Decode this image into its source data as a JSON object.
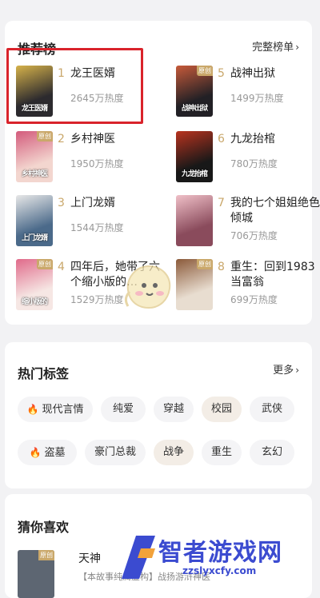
{
  "ranking": {
    "title": "推荐榜",
    "more": "完整榜单",
    "books": [
      {
        "rank": "1",
        "title": "龙王医婿",
        "heat": "2645万热度",
        "cover_text": "龙王医婿",
        "cover_color": "#2c2a2e",
        "cover_accent": "#d6b24a"
      },
      {
        "rank": "5",
        "title": "战神出狱",
        "heat": "1499万热度",
        "cover_text": "战神出狱",
        "cover_color": "#222025",
        "cover_accent": "#c75a3a",
        "badge": "原创"
      },
      {
        "rank": "2",
        "title": "乡村神医",
        "heat": "1950万热度",
        "cover_text": "乡村神医",
        "cover_color": "#f3d6cf",
        "cover_accent": "#d35b7c",
        "badge": "原创"
      },
      {
        "rank": "6",
        "title": "九龙抬棺",
        "heat": "780万热度",
        "cover_text": "九龙抬棺",
        "cover_color": "#181818",
        "cover_accent": "#b9331f"
      },
      {
        "rank": "3",
        "title": "上门龙婿",
        "heat": "1544万热度",
        "cover_text": "上门龙婿",
        "cover_color": "#4b6a8a",
        "cover_accent": "#e8e8e8"
      },
      {
        "rank": "7",
        "title": "我的七个姐姐绝色倾城",
        "heat": "706万热度",
        "cover_text": "",
        "cover_color": "#8a4b5c",
        "cover_accent": "#f0c0c8"
      },
      {
        "rank": "4",
        "title": "四年后，她带了六个缩小版的…",
        "heat": "1529万热度",
        "cover_text": "缩小版的",
        "cover_color": "#f6e7e4",
        "cover_accent": "#e06a8a",
        "badge": "原创"
      },
      {
        "rank": "8",
        "title": "重生：回到1983当富翁",
        "heat": "699万热度",
        "cover_text": "",
        "cover_color": "#e8ddd0",
        "cover_accent": "#8b5a3a",
        "badge": "原创"
      }
    ]
  },
  "tags": {
    "title": "热门标签",
    "more": "更多",
    "row1": [
      "现代言情",
      "纯爱",
      "穿越",
      "校园",
      "武侠"
    ],
    "row2": [
      "盗墓",
      "豪门总裁",
      "战争",
      "重生",
      "玄幻"
    ]
  },
  "guess": {
    "title": "猜你喜欢",
    "book_title": "天神",
    "snippet": "【本故事纯属虚构】战扬游浒神医"
  },
  "watermark": {
    "name": "智者游戏网",
    "url": "zzslyxcfy.com"
  },
  "colors": {
    "highlight": "#d9232b",
    "rank_gold": "#c9a76a",
    "fire": "#f0702a",
    "watermark_blue": "#3b4bd0"
  }
}
